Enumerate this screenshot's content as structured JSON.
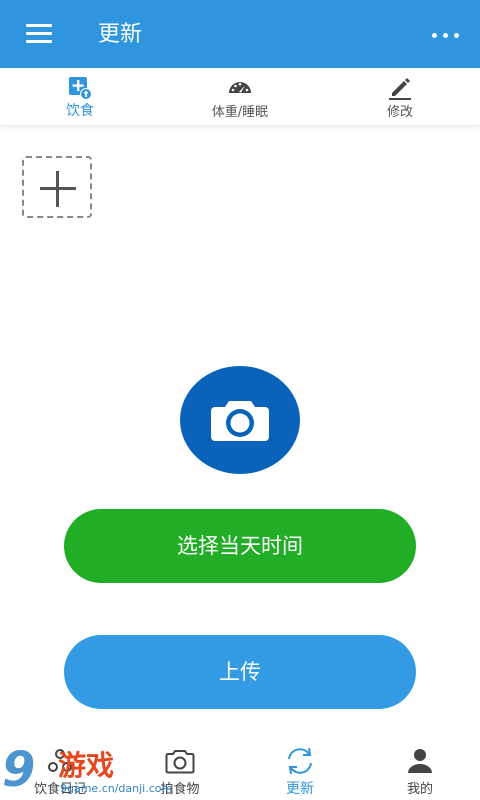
{
  "appbar": {
    "title": "更新",
    "menu_icon": "hamburger-menu-icon",
    "more_icon": "more-dots-icon"
  },
  "tabs": [
    {
      "label": "饮食",
      "icon": "add-food-icon",
      "active": true
    },
    {
      "label": "体重/睡眠",
      "icon": "gauge-icon",
      "active": false
    },
    {
      "label": "修改",
      "icon": "pencil-icon",
      "active": false
    }
  ],
  "add_photo": {
    "icon": "plus-icon"
  },
  "camera": {
    "icon": "camera-icon"
  },
  "buttons": {
    "select_time": "选择当天时间",
    "upload": "上传"
  },
  "bottom_nav": [
    {
      "label": "饮食日记",
      "icon": "diary-icon",
      "active": false
    },
    {
      "label": "拍食物",
      "icon": "camera-icon",
      "active": false
    },
    {
      "label": "更新",
      "icon": "refresh-icon",
      "active": true
    },
    {
      "label": "我的",
      "icon": "person-icon",
      "active": false
    }
  ],
  "watermark": {
    "digit": "9",
    "text": "游戏",
    "url": "9game.cn/danji.com"
  },
  "colors": {
    "primary": "#2f95de",
    "camera_bg": "#0a63ba",
    "select_time_bg": "#21ad25",
    "upload_bg": "#339be3"
  }
}
